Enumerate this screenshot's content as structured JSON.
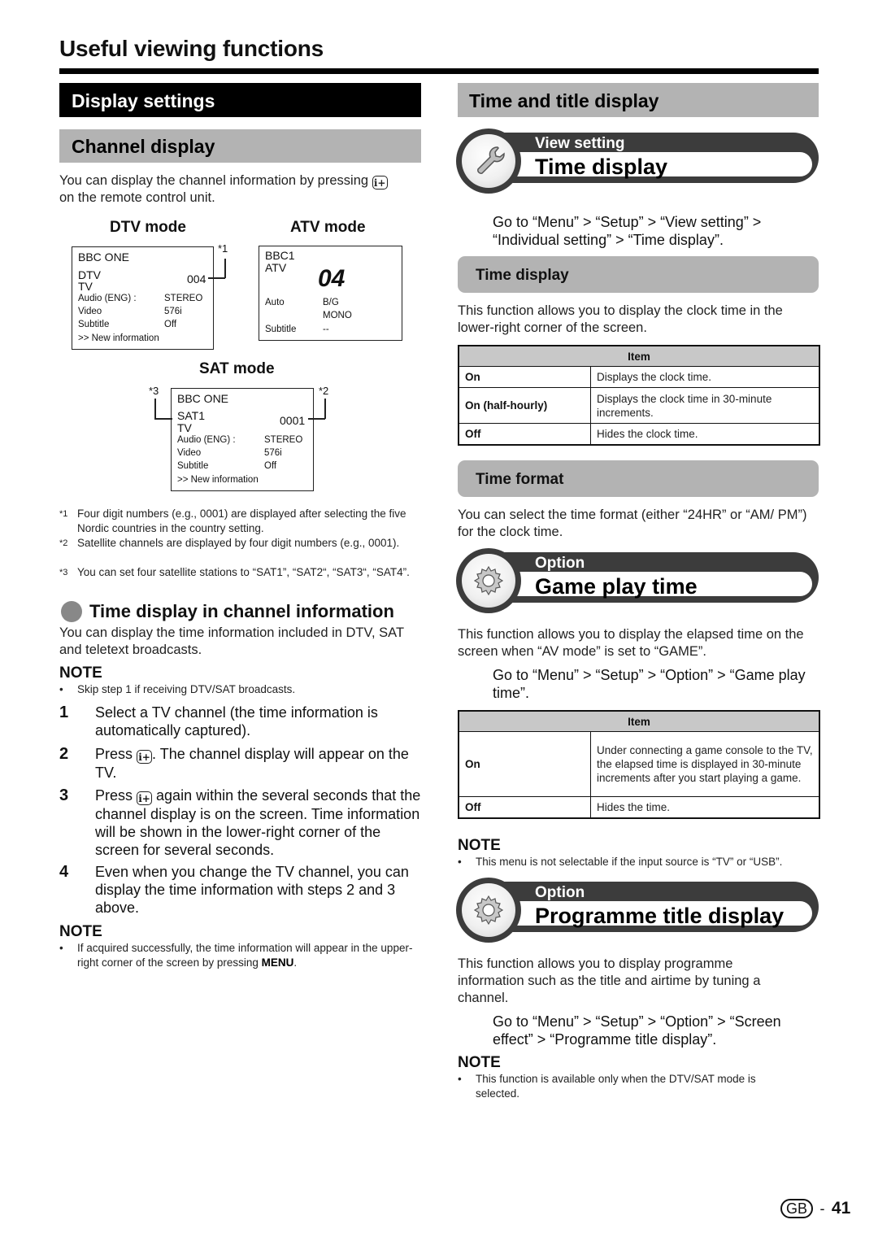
{
  "page_title": "Useful viewing functions",
  "left": {
    "section_title": "Display settings",
    "subsection_title": "Channel display",
    "intro_before_icon": "You can display the channel information by pressing",
    "intro_after_icon": "on the remote control unit.",
    "info_button_icon": "i+",
    "dtv": {
      "label": "DTV mode",
      "channel_name": "BBC ONE",
      "source": "DTV",
      "type": "TV",
      "number": "004",
      "rows": [
        {
          "k": "Audio (ENG)  :",
          "v": "STEREO"
        },
        {
          "k": "Video",
          "v": "576i"
        },
        {
          "k": "Subtitle",
          "v": "Off"
        }
      ],
      "more": ">> New information",
      "footnote_mark": "*1"
    },
    "atv": {
      "label": "ATV mode",
      "channel_name": "BBC1",
      "source": "ATV",
      "number": "04",
      "rows": [
        {
          "k": "Auto",
          "v": "B/G"
        },
        {
          "k": "",
          "v": "MONO"
        },
        {
          "k": "Subtitle",
          "v": "--"
        }
      ]
    },
    "sat": {
      "label": "SAT mode",
      "channel_name": "BBC ONE",
      "source": "SAT1",
      "type": "TV",
      "number": "0001",
      "rows": [
        {
          "k": "Audio (ENG)  :",
          "v": "STEREO"
        },
        {
          "k": "Video",
          "v": "576i"
        },
        {
          "k": "Subtitle",
          "v": "Off"
        }
      ],
      "more": ">> New information",
      "footnote_mark_left": "*3",
      "footnote_mark_right": "*2"
    },
    "footnotes": [
      {
        "mark": "*1",
        "text": "Four digit numbers (e.g., 0001) are displayed after selecting the five Nordic countries in the country setting."
      },
      {
        "mark": "*2",
        "text": "Satellite channels are displayed by four digit numbers (e.g., 0001)."
      },
      {
        "mark": "*3",
        "text": "You can set four satellite stations to “SAT1”, “SAT2“, “SAT3“, “SAT4”."
      }
    ],
    "time_info": {
      "heading": "Time display in channel information",
      "intro": "You can display the time information included in DTV, SAT and teletext broadcasts.",
      "note_heading": "NOTE",
      "note": "Skip step 1 if receiving DTV/SAT broadcasts.",
      "steps": [
        {
          "num": "1",
          "text": "Select a TV channel (the time information is automatically captured)."
        },
        {
          "num": "2",
          "before": "Press",
          "after": ". The channel display will appear on the TV."
        },
        {
          "num": "3",
          "before": "Press",
          "after": " again within the several seconds that the channel display is on the screen. Time information will be shown in the lower-right corner of the screen for several seconds."
        },
        {
          "num": "4",
          "text": "Even when you change the TV channel, you can display the time information with steps 2 and 3 above."
        }
      ],
      "note2_heading": "NOTE",
      "note2_before": "If acquired successfully, the time information will appear in the upper-right corner of the screen by pressing",
      "note2_key": "MENU",
      "note2_after": "."
    }
  },
  "right": {
    "section_title": "Time and title display",
    "time_display": {
      "category": "View setting",
      "title": "Time display",
      "icon": "wrench-icon",
      "goto": "Go to “Menu” > “Setup” > “View setting” > “Individual setting” > “Time display”.",
      "sub1_title": "Time display",
      "sub1_text": "This function allows you to display the clock time in the lower-right corner of the screen.",
      "table_header": "Item",
      "table": [
        {
          "k": "On",
          "v": "Displays the clock time."
        },
        {
          "k": "On (half-hourly)",
          "v": "Displays the clock time in 30-minute increments."
        },
        {
          "k": "Off",
          "v": "Hides the clock time."
        }
      ],
      "sub2_title": "Time format",
      "sub2_text": "You can select the time format (either “24HR” or “AM/ PM”) for the clock time."
    },
    "game_play": {
      "category": "Option",
      "title": "Game play time",
      "icon": "gear-icon",
      "text": "This function allows you to display the elapsed time on the screen when “AV mode” is set to “GAME”.",
      "goto": "Go to “Menu” > “Setup” > “Option” > “Game play time”.",
      "table_header": "Item",
      "table": [
        {
          "k": "On",
          "v": "Under connecting a game console to the TV, the elapsed time is displayed in 30-minute increments after you start playing a game."
        },
        {
          "k": "Off",
          "v": "Hides the time."
        }
      ],
      "note_heading": "NOTE",
      "note": "This menu is not selectable if the input source is “TV” or “USB”."
    },
    "programme_title": {
      "category": "Option",
      "title": "Programme title display",
      "icon": "gear-icon",
      "text": "This function allows you to display programme information such as the title and airtime by tuning a channel.",
      "goto": "Go to “Menu” > “Setup” > “Option” > “Screen effect” > “Programme title display”.",
      "note_heading": "NOTE",
      "note": "This function is available only when the DTV/SAT mode is selected."
    }
  },
  "footer": {
    "region_badge": "GB",
    "separator": "-",
    "page_number": "41"
  }
}
